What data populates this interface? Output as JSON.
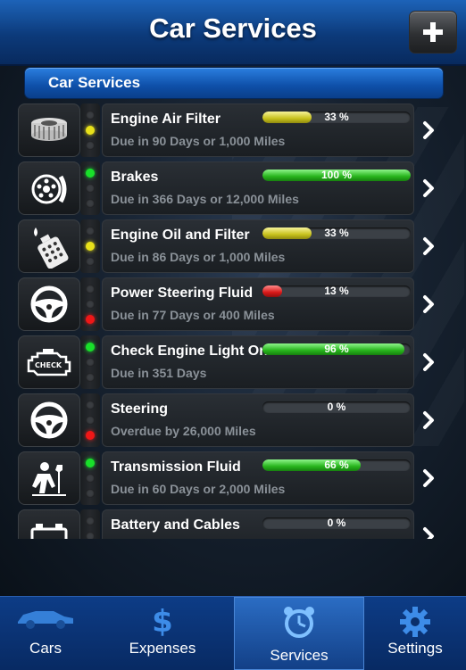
{
  "header": {
    "title": "Car Services",
    "add_label": "+"
  },
  "section": {
    "label": "Car Services"
  },
  "colors": {
    "green": "#27b41c",
    "yellow": "#c8c21c",
    "red": "#d81818",
    "accent": "#1d63b8"
  },
  "services": [
    {
      "name": "Engine Air Filter",
      "due": "Due in 90 Days or 1,000 Miles",
      "percent_label": "33 %",
      "progress": 0.33,
      "status": "yellow",
      "icon": "air-filter-icon"
    },
    {
      "name": "Brakes",
      "due": "Due in 366 Days or 12,000 Miles",
      "percent_label": "100 %",
      "progress": 1.0,
      "status": "green",
      "icon": "brake-icon"
    },
    {
      "name": "Engine Oil and Filter",
      "due": "Due in 86 Days or 1,000 Miles",
      "percent_label": "33 %",
      "progress": 0.33,
      "status": "yellow",
      "icon": "oil-can-icon"
    },
    {
      "name": "Power Steering Fluid",
      "due": "Due in 77 Days or 400 Miles",
      "percent_label": "13 %",
      "progress": 0.13,
      "status": "red",
      "icon": "steering-wheel-icon"
    },
    {
      "name": "Check Engine Light On",
      "due": "Due in 351 Days",
      "percent_label": "96 %",
      "progress": 0.96,
      "status": "green",
      "icon": "check-engine-icon"
    },
    {
      "name": "Steering",
      "due": "Overdue by 26,000 Miles",
      "percent_label": "0 %",
      "progress": 0.0,
      "status": "red",
      "icon": "steering-wheel-icon"
    },
    {
      "name": "Transmission Fluid",
      "due": "Due in 60 Days or 2,000 Miles",
      "percent_label": "66 %",
      "progress": 0.66,
      "status": "green",
      "icon": "mechanic-icon"
    },
    {
      "name": "Battery and Cables",
      "due": "",
      "percent_label": "0 %",
      "progress": 0.0,
      "status": "none",
      "icon": "battery-icon"
    }
  ],
  "tabs": [
    {
      "label": "Cars",
      "icon": "car-icon",
      "active": false
    },
    {
      "label": "Expenses",
      "icon": "dollar-icon",
      "active": false
    },
    {
      "label": "Services",
      "icon": "alarm-clock-icon",
      "active": true
    },
    {
      "label": "Settings",
      "icon": "gear-icon",
      "active": false
    }
  ]
}
